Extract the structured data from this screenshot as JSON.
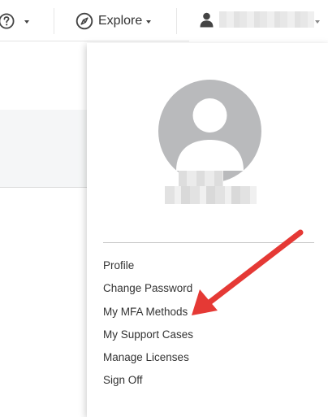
{
  "topbar": {
    "help_icon": "question-circle-icon",
    "explore_icon": "compass-icon",
    "explore_label": "Explore",
    "user_icon": "person-icon",
    "caret_icon": "caret-down-icon"
  },
  "dropdown": {
    "avatar_icon": "user-avatar-icon",
    "menu_items": [
      "Profile",
      "Change Password",
      "My MFA Methods",
      "My Support Cases",
      "Manage Licenses",
      "Sign Off"
    ]
  },
  "annotation": {
    "arrow_color": "#e53935"
  },
  "colors": {
    "avatar_background": "#b9babc",
    "divider": "#c8c8c8"
  }
}
